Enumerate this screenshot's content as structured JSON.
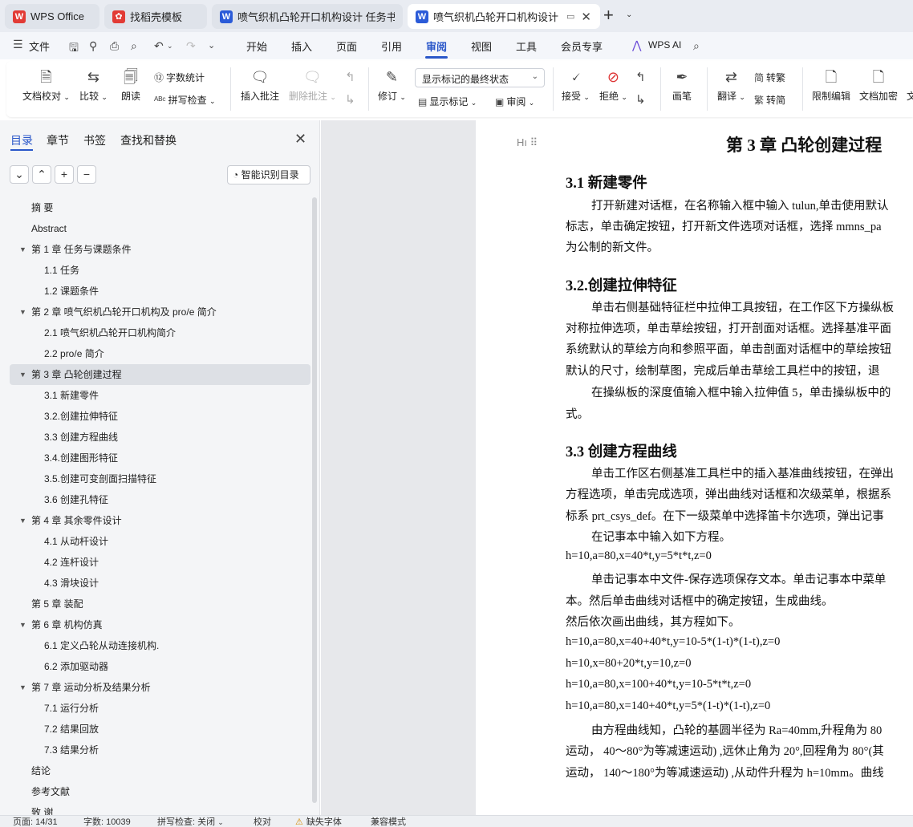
{
  "tabs": [
    {
      "title": "WPS Office",
      "logo": "W"
    },
    {
      "title": "找稻壳模板"
    },
    {
      "title": "喷气织机凸轮开口机构设计 任务书.do",
      "logo": "W"
    },
    {
      "title": "喷气织机凸轮开口机构设计 毕",
      "logo": "W",
      "active": true
    }
  ],
  "menu": {
    "file": "文件",
    "items": [
      "开始",
      "插入",
      "页面",
      "引用",
      "审阅",
      "视图",
      "工具",
      "会员专享"
    ],
    "active": "审阅",
    "wps_ai": "WPS AI"
  },
  "ribbon": {
    "doc_check": "文档校对",
    "compare": "比较",
    "read_aloud": "朗读",
    "word_count": "字数统计",
    "spell_check": "拼写检查",
    "insert_comment": "插入批注",
    "delete_comment": "删除批注",
    "revise": "修订",
    "markup_select": "显示标记的最终状态",
    "show_markup": "显示标记",
    "review": "审阅",
    "accept": "接受",
    "reject": "拒绝",
    "pen": "画笔",
    "translate": "翻译",
    "to_traditional": "转繁",
    "to_simplified": "转简",
    "restrict_edit": "限制编辑",
    "encrypt": "文档加密",
    "cut_char": "文"
  },
  "nav": {
    "tabs": [
      "目录",
      "章节",
      "书签",
      "查找和替换"
    ],
    "smart_toc": "智能识别目录",
    "toc": [
      {
        "text": "摘  要",
        "level": 0
      },
      {
        "text": "Abstract",
        "level": 0
      },
      {
        "text": "第 1 章  任务与课题条件",
        "level": 0,
        "expanded": true
      },
      {
        "text": "1.1  任务",
        "level": 1
      },
      {
        "text": "1.2  课题条件",
        "level": 1
      },
      {
        "text": "第 2 章  喷气织机凸轮开口机构及 pro/e 简介",
        "level": 0,
        "expanded": true
      },
      {
        "text": "2.1  喷气织机凸轮开口机构简介",
        "level": 1
      },
      {
        "text": "2.2 pro/e 简介",
        "level": 1
      },
      {
        "text": "第 3 章  凸轮创建过程",
        "level": 0,
        "expanded": true,
        "selected": true
      },
      {
        "text": "3.1  新建零件",
        "level": 1
      },
      {
        "text": "3.2.创建拉伸特征",
        "level": 1
      },
      {
        "text": "3.3  创建方程曲线",
        "level": 1
      },
      {
        "text": "3.4.创建图形特征",
        "level": 1
      },
      {
        "text": "3.5.创建可变剖面扫描特征",
        "level": 1
      },
      {
        "text": "3.6 创建孔特征",
        "level": 1
      },
      {
        "text": "第 4 章    其余零件设计",
        "level": 0,
        "expanded": true
      },
      {
        "text": "4.1 从动杆设计",
        "level": 1
      },
      {
        "text": "4.2 连杆设计",
        "level": 1
      },
      {
        "text": "4.3 滑块设计",
        "level": 1
      },
      {
        "text": "第 5 章  装配",
        "level": 0
      },
      {
        "text": "第 6 章  机构仿真",
        "level": 0,
        "expanded": true
      },
      {
        "text": "6.1  定义凸轮从动连接机构.",
        "level": 1
      },
      {
        "text": "6.2  添加驱动器",
        "level": 1
      },
      {
        "text": "第 7 章    运动分析及结果分析",
        "level": 0,
        "expanded": true
      },
      {
        "text": "7.1  运行分析",
        "level": 1
      },
      {
        "text": "7.2    结果回放",
        "level": 1
      },
      {
        "text": "7.3    结果分析",
        "level": 1
      },
      {
        "text": "结论",
        "level": 0
      },
      {
        "text": "参考文献",
        "level": 0
      },
      {
        "text": "致  谢",
        "level": 0
      }
    ]
  },
  "doc": {
    "lines": [
      "第 3 章  凸轮创建过程",
      "3.1  新建零件",
      "打开新建对话框，在名称输入框中输入 tulun,单击使用默认",
      "标志，单击确定按钮，打开新文件选项对话框，选择 mmns_pa",
      "为公制的新文件。",
      "3.2.创建拉伸特征",
      "单击右侧基础特征栏中拉伸工具按钮，在工作区下方操纵板",
      "对称拉伸选项，单击草绘按钮，打开剖面对话框。选择基准平面",
      "系统默认的草绘方向和参照平面，单击剖面对话框中的草绘按钮",
      "默认的尺寸，绘制草图，完成后单击草绘工具栏中的按钮，退",
      "在操纵板的深度值输入框中输入拉伸值 5，单击操纵板中的",
      "式。",
      "3.3  创建方程曲线",
      "单击工作区右侧基准工具栏中的插入基准曲线按钮，在弹出",
      "方程选项，单击完成选项，弹出曲线对话框和次级菜单，根据系",
      "标系 prt_csys_def。在下一级菜单中选择笛卡尔选项，弹出记事",
      "在记事本中输入如下方程。",
      "h=10,a=80,x=40*t,y=5*t*t,z=0",
      "单击记事本中文件-保存选项保存文本。单击记事本中菜单",
      "本。然后单击曲线对话框中的确定按钮，生成曲线。",
      "然后依次画出曲线，其方程如下。",
      "h=10,a=80,x=40+40*t,y=10-5*(1-t)*(1-t),z=0",
      "h=10,x=80+20*t,y=10,z=0",
      "h=10,a=80,x=100+40*t,y=10-5*t*t,z=0",
      "h=10,a=80,x=140+40*t,y=5*(1-t)*(1-t),z=0",
      "由方程曲线知，凸轮的基圆半径为  Ra=40mm,升程角为  80",
      "运动， 40～80°为等减速运动) ,远休止角为 20°,回程角为  80°(其",
      "运动， 140～180°为等减速运动) ,从动件升程为 h=10mm。曲线"
    ]
  },
  "status": {
    "page": "页面: 14/31",
    "words": "字数: 10039",
    "spell": "拼写检查: 关闭",
    "proof": "校对",
    "missing_font": "缺失字体",
    "compat": "兼容模式"
  }
}
